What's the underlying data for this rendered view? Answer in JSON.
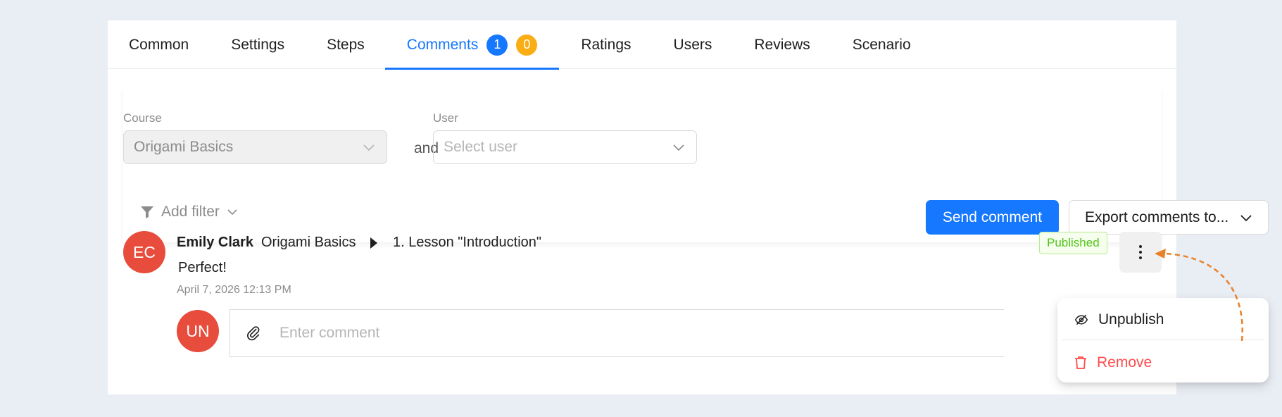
{
  "tabs": [
    {
      "label": "Common"
    },
    {
      "label": "Settings"
    },
    {
      "label": "Steps"
    },
    {
      "label": "Comments",
      "badge_blue": "1",
      "badge_orange": "0"
    },
    {
      "label": "Ratings"
    },
    {
      "label": "Users"
    },
    {
      "label": "Reviews"
    },
    {
      "label": "Scenario"
    }
  ],
  "filters": {
    "course_label": "Course",
    "course_value": "Origami Basics",
    "and_text": "and",
    "user_label": "User",
    "user_placeholder": "Select user",
    "add_filter": "Add filter",
    "send_comment": "Send comment",
    "export": "Export comments to..."
  },
  "comment": {
    "avatar_initials": "EC",
    "author": "Emily Clark",
    "course": "Origami Basics",
    "lesson": "1. Lesson \"Introduction\"",
    "text": "Perfect!",
    "date": "April 7, 2026 12:13 PM",
    "status": "Published"
  },
  "reply": {
    "avatar_initials": "UN",
    "placeholder": "Enter comment"
  },
  "menu": {
    "unpublish": "Unpublish",
    "remove": "Remove"
  },
  "colors": {
    "accent": "#1677ff",
    "badge_orange": "#faad14",
    "avatar": "#e74c3c",
    "danger": "#ff4d4f",
    "published": "#52c41a",
    "annotation": "#e8822a"
  }
}
